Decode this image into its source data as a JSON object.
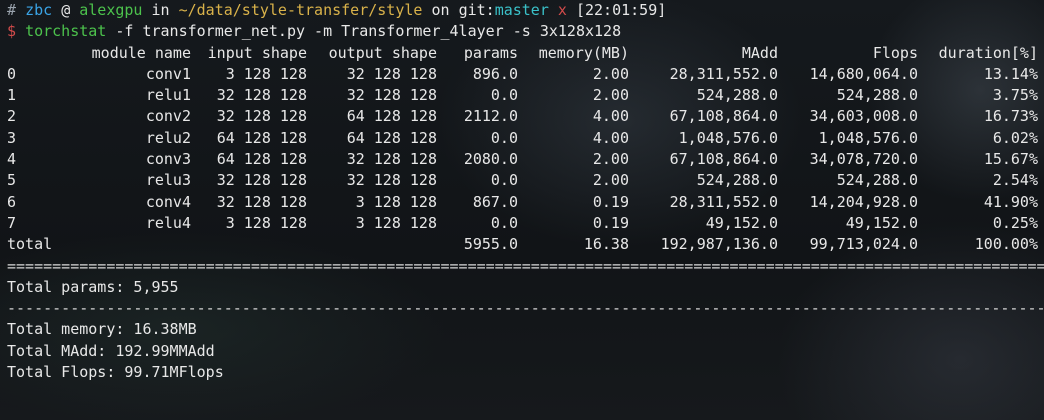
{
  "prompt": {
    "hash": "#",
    "user": "zbc",
    "at": "@",
    "host": "alexgpu",
    "in": "in",
    "path": "~/data/style-transfer/style",
    "on": "on",
    "git_label": "git:",
    "branch": "master",
    "dirty_marker": "x",
    "time": "[22:01:59]"
  },
  "command": {
    "dollar": "$",
    "program": "torchstat",
    "args": "-f transformer_net.py -m Transformer_4layer -s 3x128x128"
  },
  "table": {
    "headers": {
      "module_name": "module name",
      "input_shape": "input shape",
      "output_shape": "output shape",
      "params": "params",
      "memory": "memory(MB)",
      "madd": "MAdd",
      "flops": "Flops",
      "duration": "duration[%]"
    },
    "rows": [
      {
        "idx": "0",
        "name": "conv1",
        "in": "3 128 128",
        "out": "32 128 128",
        "params": "896.0",
        "mem": "2.00",
        "madd": "28,311,552.0",
        "flops": "14,680,064.0",
        "dur": "13.14%"
      },
      {
        "idx": "1",
        "name": "relu1",
        "in": "32 128 128",
        "out": "32 128 128",
        "params": "0.0",
        "mem": "2.00",
        "madd": "524,288.0",
        "flops": "524,288.0",
        "dur": "3.75%"
      },
      {
        "idx": "2",
        "name": "conv2",
        "in": "32 128 128",
        "out": "64 128 128",
        "params": "2112.0",
        "mem": "4.00",
        "madd": "67,108,864.0",
        "flops": "34,603,008.0",
        "dur": "16.73%"
      },
      {
        "idx": "3",
        "name": "relu2",
        "in": "64 128 128",
        "out": "64 128 128",
        "params": "0.0",
        "mem": "4.00",
        "madd": "1,048,576.0",
        "flops": "1,048,576.0",
        "dur": "6.02%"
      },
      {
        "idx": "4",
        "name": "conv3",
        "in": "64 128 128",
        "out": "32 128 128",
        "params": "2080.0",
        "mem": "2.00",
        "madd": "67,108,864.0",
        "flops": "34,078,720.0",
        "dur": "15.67%"
      },
      {
        "idx": "5",
        "name": "relu3",
        "in": "32 128 128",
        "out": "32 128 128",
        "params": "0.0",
        "mem": "2.00",
        "madd": "524,288.0",
        "flops": "524,288.0",
        "dur": "2.54%"
      },
      {
        "idx": "6",
        "name": "conv4",
        "in": "32 128 128",
        "out": "3 128 128",
        "params": "867.0",
        "mem": "0.19",
        "madd": "28,311,552.0",
        "flops": "14,204,928.0",
        "dur": "41.90%"
      },
      {
        "idx": "7",
        "name": "relu4",
        "in": "3 128 128",
        "out": "3 128 128",
        "params": "0.0",
        "mem": "0.19",
        "madd": "49,152.0",
        "flops": "49,152.0",
        "dur": "0.25%"
      }
    ],
    "total": {
      "label": "total",
      "params": "5955.0",
      "mem": "16.38",
      "madd": "192,987,136.0",
      "flops": "99,713,024.0",
      "dur": "100.00%"
    }
  },
  "summary": {
    "separator_double": "=================================================================================================================================================================================",
    "separator_single": "-----------------------------------------------------------------------------------------------------------------------------------------------------------------------------",
    "total_params": "Total params: 5,955",
    "total_memory": "Total memory: 16.38MB",
    "total_madd": "Total MAdd: 192.99MMAdd",
    "total_flops": "Total Flops: 99.71MFlops"
  }
}
